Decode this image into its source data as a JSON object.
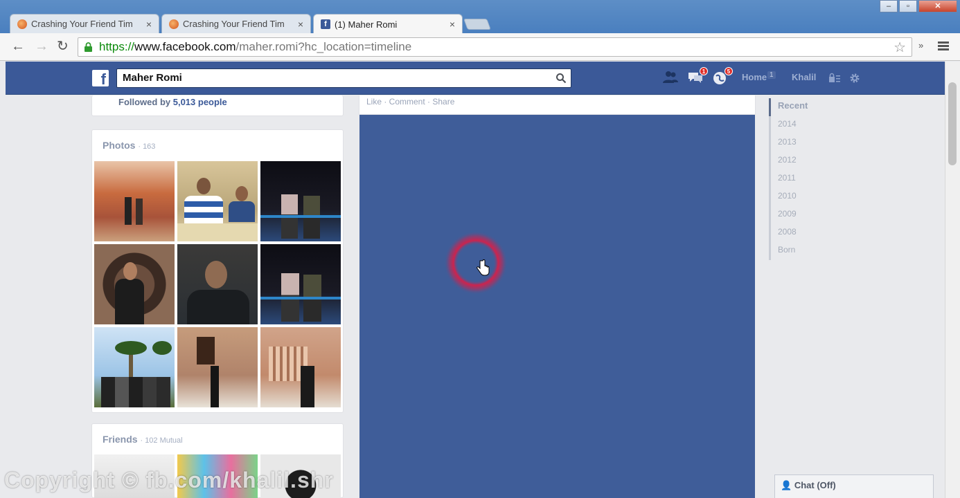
{
  "browser": {
    "tabs": [
      {
        "title": "Crashing Your Friend Tim",
        "icon": "orange-circle-favicon"
      },
      {
        "title": "Crashing Your Friend Tim",
        "icon": "orange-circle-favicon"
      },
      {
        "title": "(1) Maher Romi",
        "icon": "facebook-favicon"
      }
    ],
    "close_glyph": "×",
    "url_scheme": "https://",
    "url_host": "www.facebook.com",
    "url_path": "/maher.romi?hc_location=timeline",
    "extensions_glyph": "»"
  },
  "fb_header": {
    "logo_letter": "f",
    "search_value": "Maher Romi",
    "friend_requests_icon": "friend-requests-icon",
    "messages_badge": "1",
    "notifications_badge": "5",
    "home_label": "Home",
    "home_count": "1",
    "user_label": "Khalil"
  },
  "profile": {
    "followed_prefix": "Followed by ",
    "followed_count": "5,013 people",
    "photos_title": "Photos",
    "photos_count": "· 163",
    "friends_title": "Friends",
    "friends_count": "· 102 Mutual"
  },
  "story": {
    "actions": "Like · Comment · Share"
  },
  "timeline_nav": [
    "Recent",
    "2014",
    "2013",
    "2012",
    "2011",
    "2010",
    "2009",
    "2008",
    "Born"
  ],
  "chat": {
    "label": "Chat (Off)"
  },
  "watermark": "Copyright © fb.com/khalil.shr",
  "colors": {
    "facebook_blue": "#3b5998",
    "page_bg": "#e9eaed",
    "panel_blue": "#3f5d99"
  }
}
